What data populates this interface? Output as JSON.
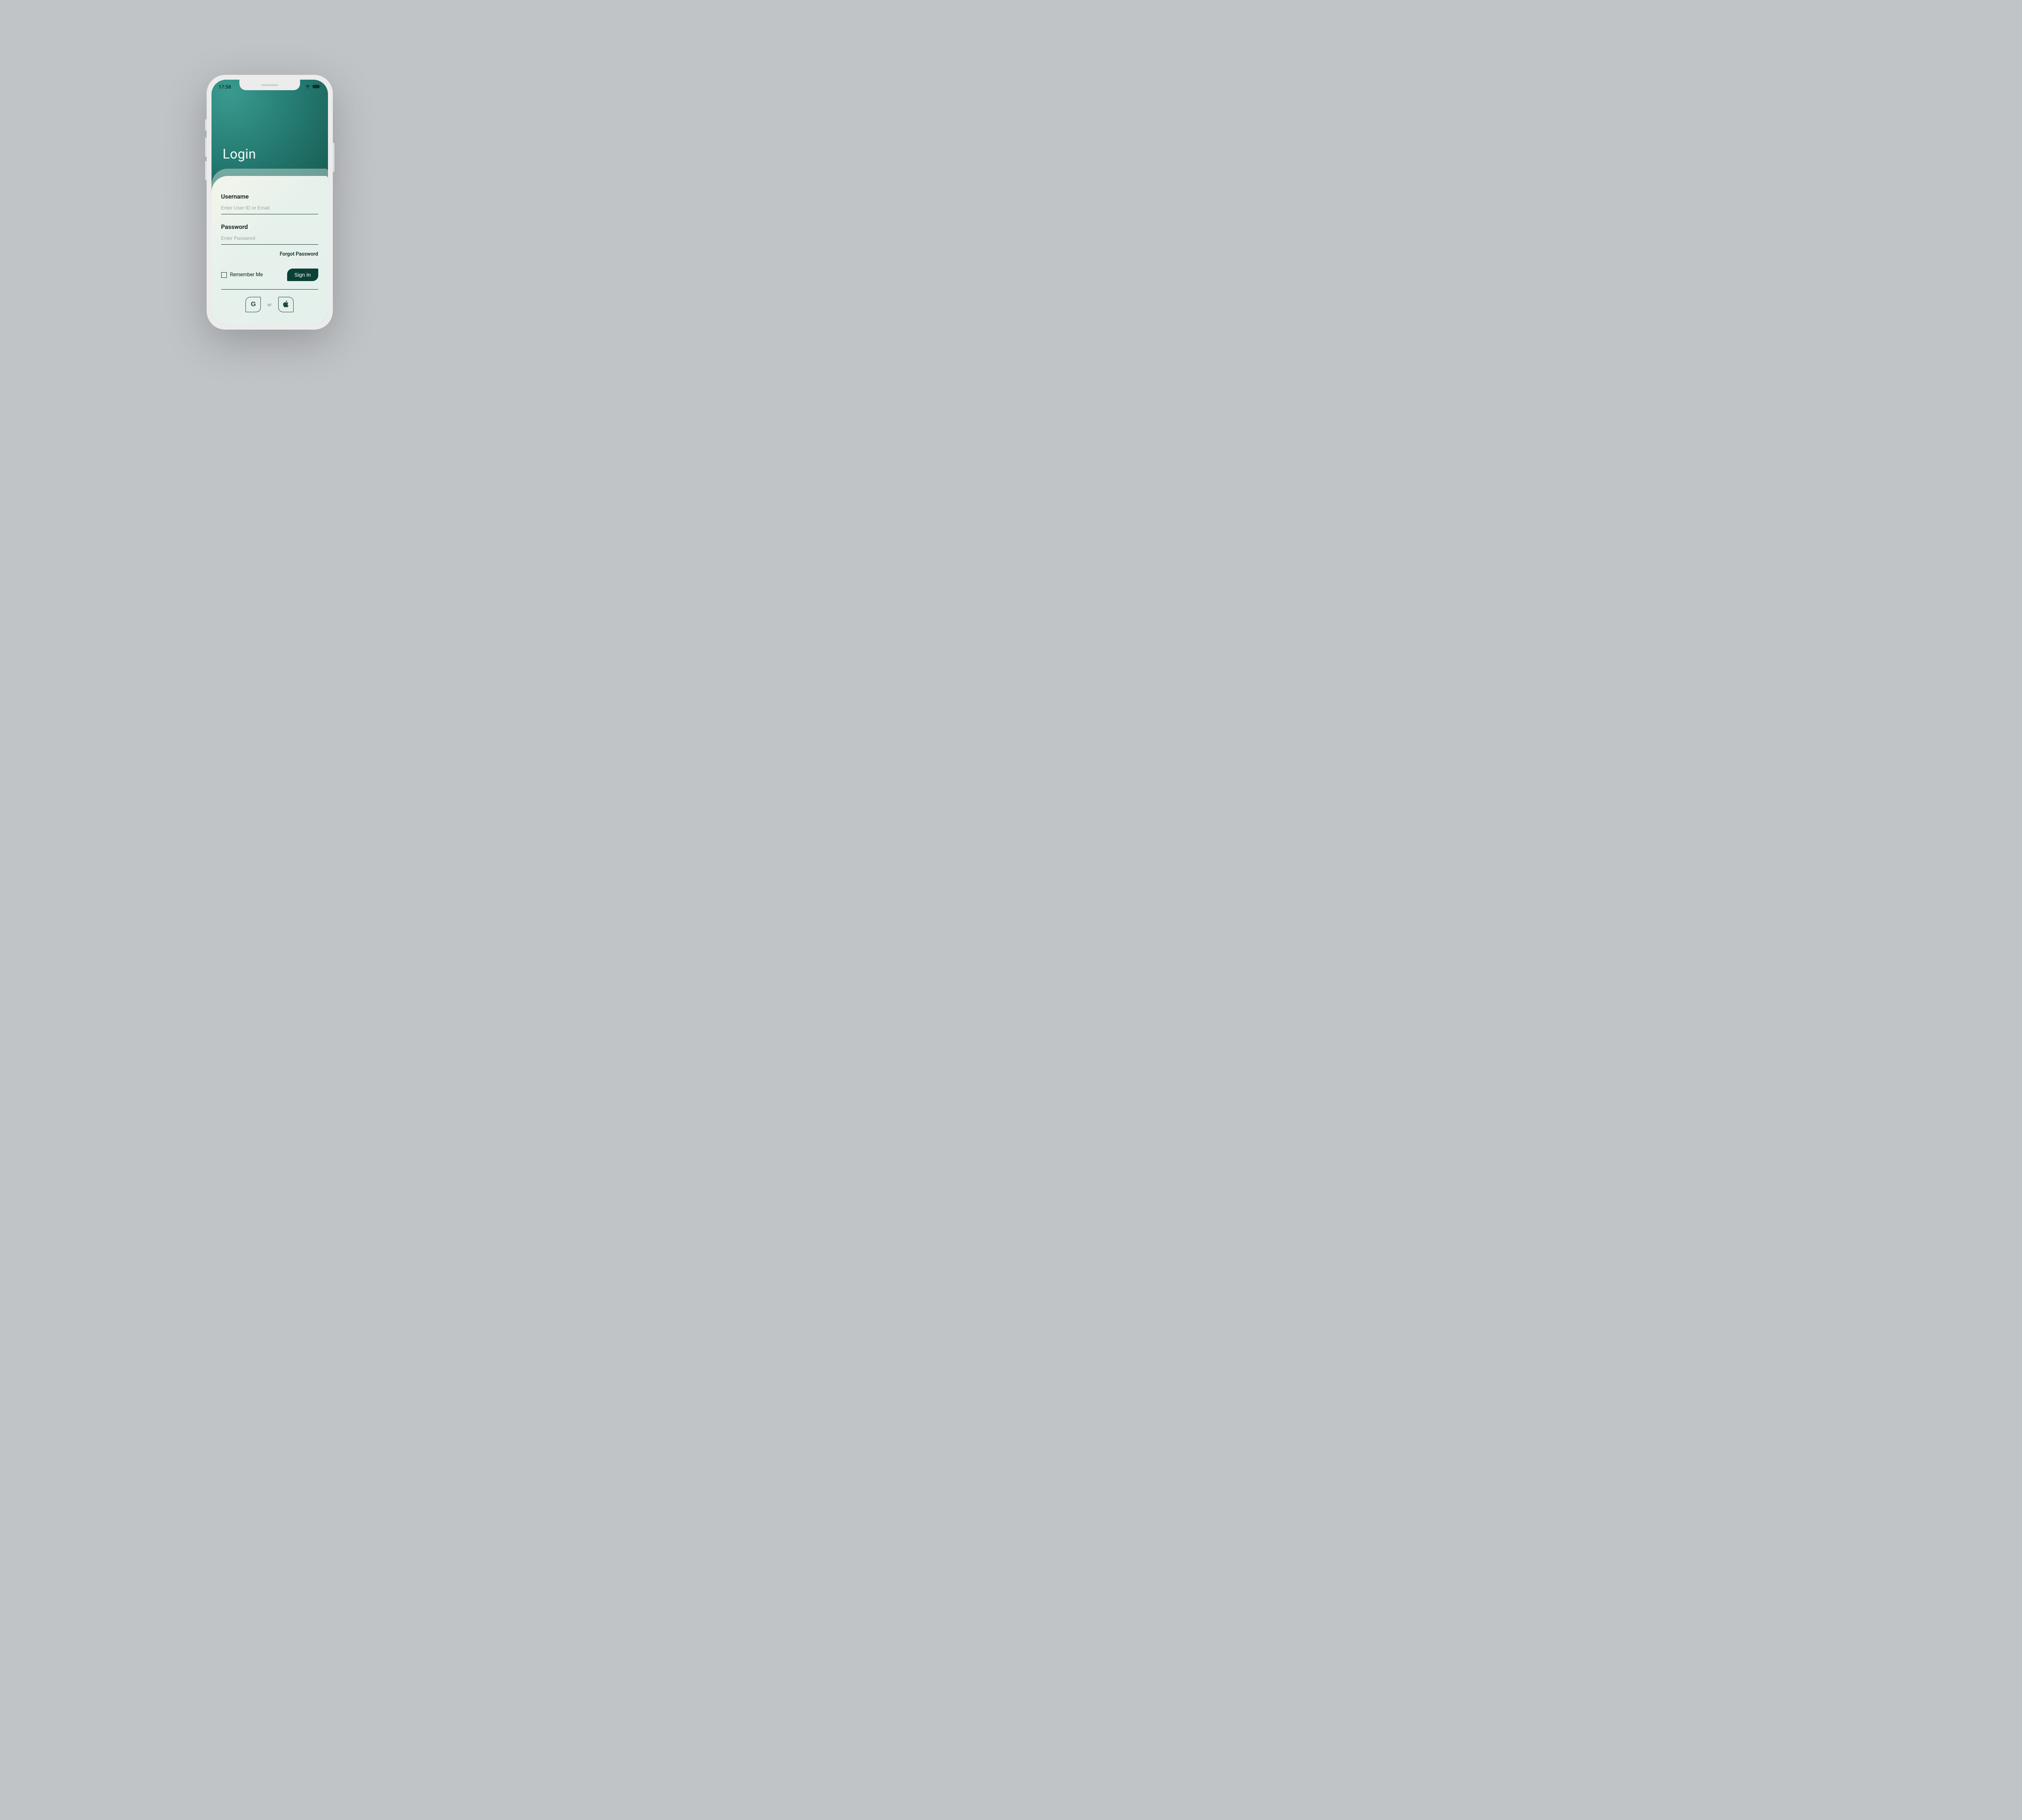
{
  "status": {
    "time": "17:58"
  },
  "header": {
    "title": "Login"
  },
  "form": {
    "username_label": "Username",
    "username_placeholder": "Enter User ID or Email",
    "password_label": "Password",
    "password_placeholder": "Enter Password",
    "forgot_label": "Forgot Password",
    "remember_label": "Remember Me",
    "signin_label": "Sign In"
  },
  "social": {
    "or_label": "or",
    "google_label": "G"
  }
}
